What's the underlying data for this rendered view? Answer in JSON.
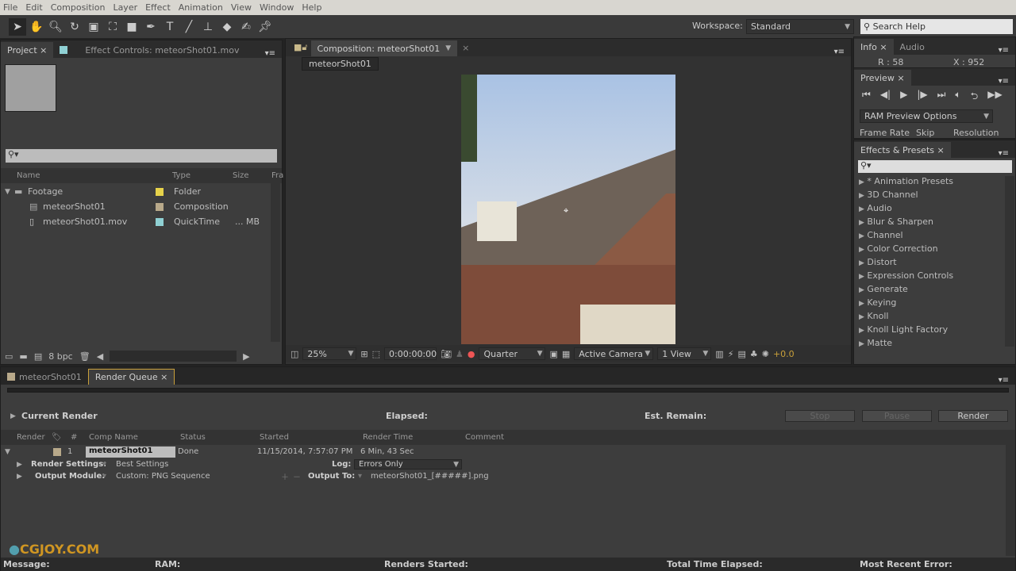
{
  "menu": [
    "File",
    "Edit",
    "Composition",
    "Layer",
    "Effect",
    "Animation",
    "View",
    "Window",
    "Help"
  ],
  "toolbar": {
    "tools": [
      "selection-tool",
      "hand-tool",
      "zoom-tool",
      "rotation-tool",
      "camera-tool",
      "pan-behind-tool",
      "rectangle-tool",
      "pen-tool",
      "type-tool",
      "brush-tool",
      "clone-stamp-tool",
      "eraser-tool",
      "roto-brush-tool",
      "puppet-pin-tool"
    ],
    "workspace_label": "Workspace:",
    "workspace_value": "Standard",
    "search_placeholder": "Search Help"
  },
  "project": {
    "tab": "Project",
    "effect_tab": "Effect Controls: meteorShot01.mov",
    "columns": [
      "Name",
      "Type",
      "Size",
      "Fra"
    ],
    "items": [
      {
        "name": "Footage",
        "type": "Folder",
        "size": "",
        "color": "#e6d24a"
      },
      {
        "name": "meteorShot01",
        "type": "Composition",
        "size": "",
        "color": "#b8a98a"
      },
      {
        "name": "meteorShot01.mov",
        "type": "QuickTime",
        "size": "... MB",
        "color": "#8fd0d3"
      }
    ],
    "bpc": "8 bpc"
  },
  "comp": {
    "tab": "Composition: meteorShot01",
    "subtab": "meteorShot01",
    "zoom": "25%",
    "timecode": "0:00:00:00",
    "resolution": "Quarter",
    "camera": "Active Camera",
    "views": "1 View",
    "exposure": "+0.0"
  },
  "info": {
    "tab": "Info",
    "audio_tab": "Audio",
    "r": "R : 58",
    "x": "X : 952"
  },
  "preview": {
    "tab": "Preview",
    "options": "RAM Preview Options",
    "frame_rate": "Frame Rate",
    "skip": "Skip",
    "resolution": "Resolution"
  },
  "effects": {
    "tab": "Effects & Presets",
    "items": [
      "* Animation Presets",
      "3D Channel",
      "Audio",
      "Blur & Sharpen",
      "Channel",
      "Color Correction",
      "Distort",
      "Expression Controls",
      "Generate",
      "Keying",
      "Knoll",
      "Knoll Light Factory",
      "Matte"
    ]
  },
  "bottom": {
    "tab1": "meteorShot01",
    "tab2": "Render Queue",
    "current_render": "Current Render",
    "elapsed": "Elapsed:",
    "est_remain": "Est. Remain:",
    "stop": "Stop",
    "pause": "Pause",
    "render": "Render",
    "columns": [
      "Render",
      "#",
      "Comp Name",
      "Status",
      "Started",
      "Render Time",
      "Comment"
    ],
    "item": {
      "num": "1",
      "comp": "meteorShot01",
      "status": "Done",
      "started": "11/15/2014, 7:57:07 PM",
      "render_time": "6 Min, 43 Sec"
    },
    "render_settings_label": "Render Settings:",
    "render_settings": "Best Settings",
    "log_label": "Log:",
    "log": "Errors Only",
    "output_module_label": "Output Module:",
    "output_module": "Custom: PNG Sequence",
    "output_to_label": "Output To:",
    "output_to": "meteorShot01_[#####].png",
    "status": {
      "message": "Message:",
      "ram": "RAM:",
      "renders_started": "Renders Started:",
      "total_elapsed": "Total Time Elapsed:",
      "recent_error": "Most Recent Error:"
    }
  },
  "watermark": "CGJOY.COM"
}
